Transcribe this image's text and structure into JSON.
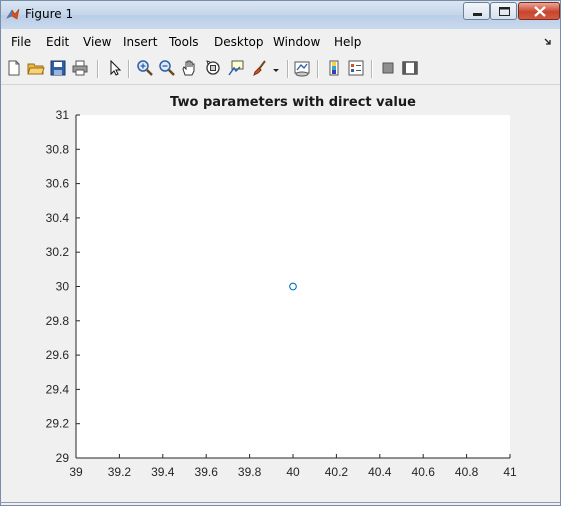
{
  "window": {
    "title": "Figure 1",
    "controls": [
      "minimize-icon",
      "maximize-icon",
      "close-icon"
    ]
  },
  "menu": {
    "items": [
      "File",
      "Edit",
      "View",
      "Insert",
      "Tools",
      "Desktop",
      "Window",
      "Help"
    ],
    "overflow_icon": "dock-arrow-icon"
  },
  "toolbar": {
    "tools": [
      "new-figure-icon",
      "open-file-icon",
      "save-icon",
      "print-icon",
      "edit-plot-arrow-icon",
      "zoom-in-icon",
      "zoom-out-icon",
      "pan-hand-icon",
      "rotate-3d-icon",
      "data-cursor-icon",
      "brush-icon",
      "brush-dropdown-icon",
      "link-plot-icon",
      "insert-colorbar-icon",
      "insert-legend-icon",
      "hide-plot-tools-icon",
      "show-plot-tools-icon"
    ]
  },
  "colors": {
    "marker": "#0072bd",
    "axes_background": "#ffffff",
    "figure_background": "#f0f0f0"
  },
  "chart_data": {
    "type": "scatter",
    "title": "Two parameters with direct value",
    "xlabel": "",
    "ylabel": "",
    "xlim": [
      39,
      41
    ],
    "ylim": [
      29,
      31
    ],
    "x_ticks": [
      "39",
      "39.2",
      "39.4",
      "39.6",
      "39.8",
      "40",
      "40.2",
      "40.4",
      "40.6",
      "40.8",
      "41"
    ],
    "y_ticks": [
      "29",
      "29.2",
      "29.4",
      "29.6",
      "29.8",
      "30",
      "30.2",
      "30.4",
      "30.6",
      "30.8",
      "31"
    ],
    "grid": false,
    "marker": "circle",
    "points": [
      {
        "x": 40,
        "y": 30
      }
    ]
  }
}
